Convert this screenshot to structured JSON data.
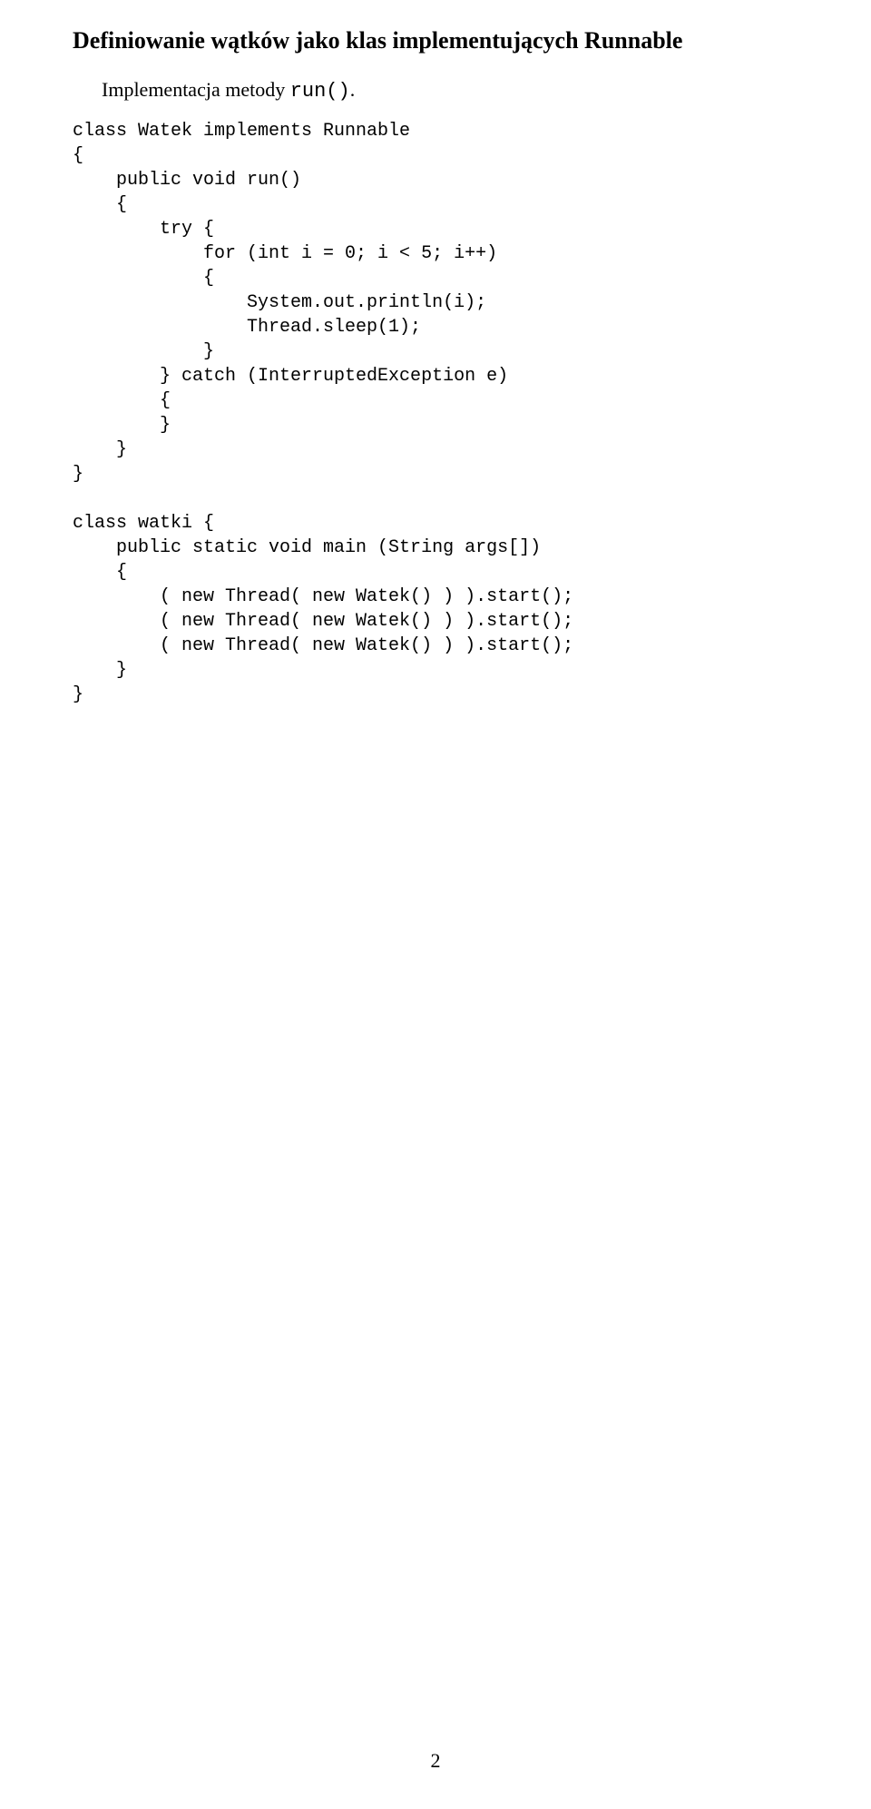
{
  "heading": "Definiowanie wątków jako klas implementujących Runnable",
  "intro_prefix": "Implementacja metody ",
  "intro_code": "run()",
  "intro_suffix": ".",
  "code": "class Watek implements Runnable\n{\n    public void run()\n    {\n        try {\n            for (int i = 0; i < 5; i++)\n            {\n                System.out.println(i);\n                Thread.sleep(1);\n            }\n        } catch (InterruptedException e)\n        {\n        }\n    }\n}\n\nclass watki {\n    public static void main (String args[])\n    {\n        ( new Thread( new Watek() ) ).start();\n        ( new Thread( new Watek() ) ).start();\n        ( new Thread( new Watek() ) ).start();\n    }\n}",
  "page_number": "2"
}
